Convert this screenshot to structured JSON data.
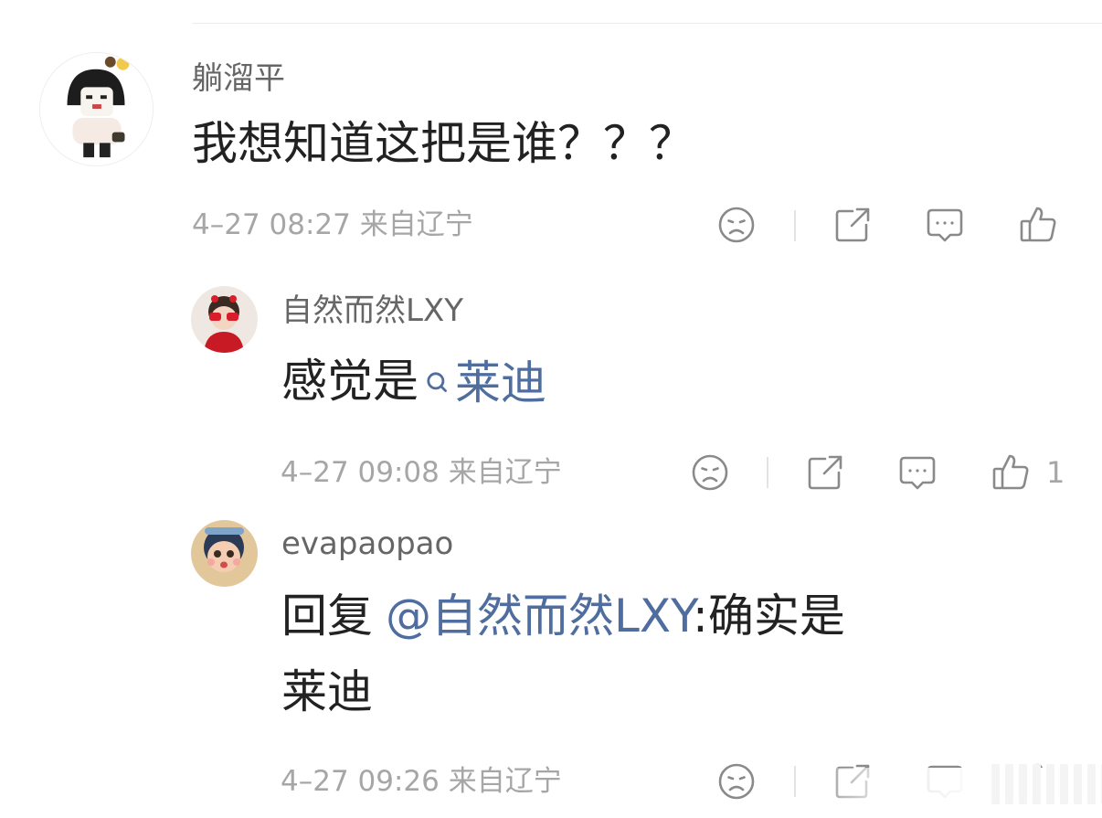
{
  "comments": [
    {
      "author": "躺溜平",
      "text": "我想知道这把是谁？？？",
      "meta": "4–27 08:27 来自辽宁"
    },
    {
      "author": "自然而然LXY",
      "text_prefix": "感觉是",
      "text_link": "莱迪",
      "meta": "4–27 09:08 来自辽宁",
      "like_count": "1"
    },
    {
      "author": "evapaopao",
      "line1_prefix": "回复",
      "line1_mention": "@自然而然LXY",
      "line1_suffix": ":确实是",
      "line2": "莱迪",
      "meta": "4–27 09:26 来自辽宁"
    }
  ],
  "icons": [
    "dislike-face-icon",
    "share-icon",
    "comment-icon",
    "like-thumb-icon",
    "search-icon"
  ],
  "colors": {
    "link": "#4f6d9e",
    "meta": "#a6a6a6",
    "icon": "#8a8a8a"
  }
}
